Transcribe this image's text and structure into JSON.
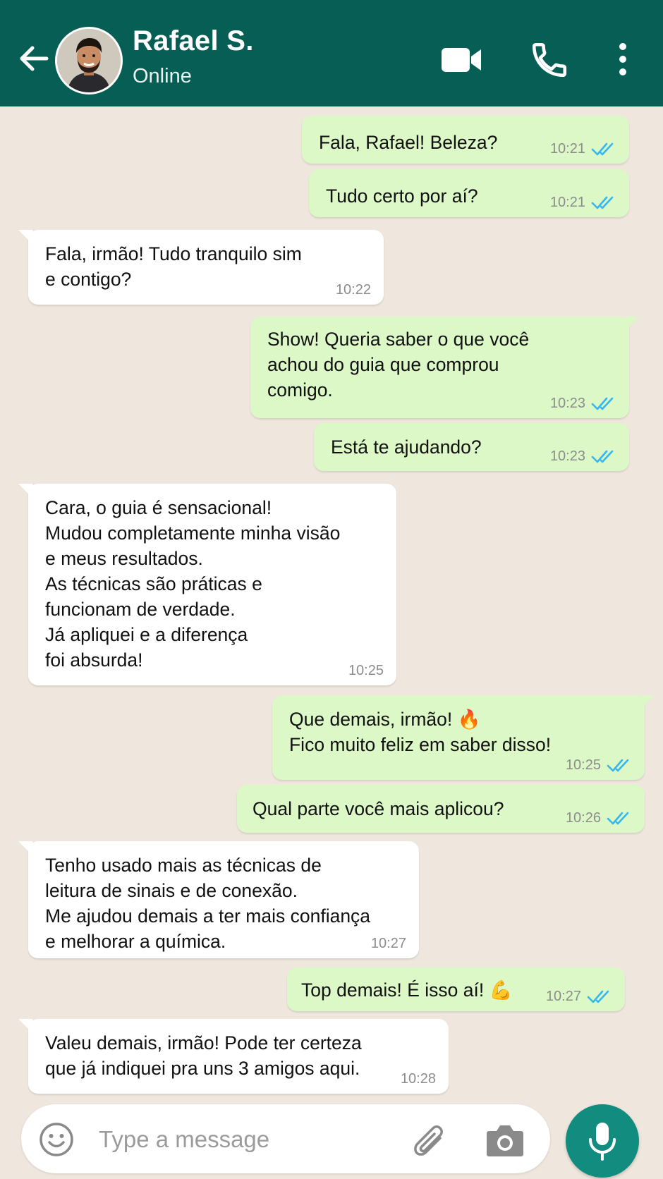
{
  "colors": {
    "header": "#075e54",
    "chat_background": "#efe7de",
    "outgoing_bubble": "#dcf8c6",
    "incoming_bubble": "#ffffff",
    "read_ticks": "#34b7f1",
    "mic_button": "#128c7e"
  },
  "header": {
    "contact_name": "Rafael S.",
    "status": "Online",
    "icons": [
      "back-arrow-icon",
      "avatar",
      "video-call-icon",
      "phone-icon",
      "more-vertical-icon"
    ]
  },
  "messages": [
    {
      "direction": "out",
      "lines": [
        "Fala, Rafael! Beleza?"
      ],
      "time": "10:21",
      "status": "read"
    },
    {
      "direction": "out",
      "lines": [
        "Tudo certo por aí?"
      ],
      "time": "10:21",
      "status": "read"
    },
    {
      "direction": "in",
      "lines": [
        "Fala, irmão! Tudo tranquilo sim",
        "e contigo?"
      ],
      "time": "10:22"
    },
    {
      "direction": "out",
      "lines": [
        "Show! Queria saber o que você",
        "achou do guia que comprou",
        "comigo."
      ],
      "time": "10:23",
      "status": "read"
    },
    {
      "direction": "out",
      "lines": [
        "Está te ajudando?"
      ],
      "time": "10:23",
      "status": "read"
    },
    {
      "direction": "in",
      "lines": [
        "Cara, o guia é sensacional!",
        "Mudou completamente minha visão",
        "e meus resultados.",
        "As técnicas são práticas e",
        "funcionam de verdade.",
        "Já apliquei e a diferença",
        "foi absurda!"
      ],
      "time": "10:25"
    },
    {
      "direction": "out",
      "lines": [
        "Que demais, irmão! 🔥",
        "Fico muito feliz em saber disso!"
      ],
      "time": "10:25",
      "status": "read"
    },
    {
      "direction": "out",
      "lines": [
        "Qual parte você mais aplicou?"
      ],
      "time": "10:26",
      "status": "read"
    },
    {
      "direction": "in",
      "lines": [
        "Tenho usado mais as técnicas de",
        "leitura de sinais e de conexão.",
        "Me ajudou demais a ter mais confiança",
        "e melhorar a química."
      ],
      "time": "10:27"
    },
    {
      "direction": "out",
      "lines": [
        "Top demais! É isso aí! 💪"
      ],
      "time": "10:27",
      "status": "read"
    },
    {
      "direction": "in",
      "lines": [
        "Valeu demais, irmão! Pode ter certeza",
        "que já indiquei pra uns 3 amigos aqui."
      ],
      "time": "10:28"
    }
  ],
  "composer": {
    "placeholder": "Type a message",
    "icons": [
      "emoji-icon",
      "attach-icon",
      "camera-icon",
      "mic-icon"
    ]
  }
}
